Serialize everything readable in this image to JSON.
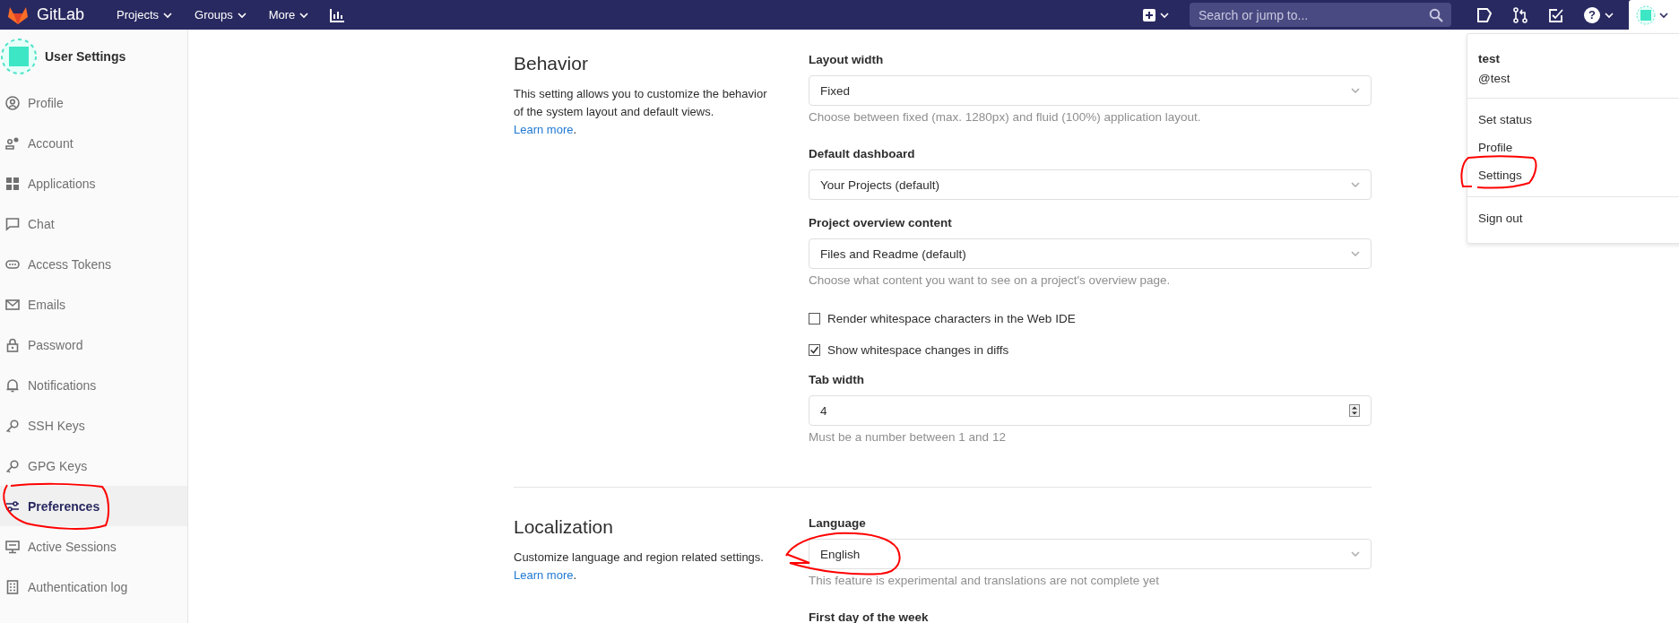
{
  "topbar": {
    "brand": "GitLab",
    "nav": [
      {
        "label": "Projects"
      },
      {
        "label": "Groups"
      },
      {
        "label": "More"
      }
    ],
    "search": {
      "placeholder": "Search or jump to..."
    },
    "help_glyph": "?"
  },
  "sidebar": {
    "title": "User Settings",
    "items": [
      {
        "label": "Profile",
        "selected": false
      },
      {
        "label": "Account",
        "selected": false
      },
      {
        "label": "Applications",
        "selected": false
      },
      {
        "label": "Chat",
        "selected": false
      },
      {
        "label": "Access Tokens",
        "selected": false
      },
      {
        "label": "Emails",
        "selected": false
      },
      {
        "label": "Password",
        "selected": false
      },
      {
        "label": "Notifications",
        "selected": false
      },
      {
        "label": "SSH Keys",
        "selected": false
      },
      {
        "label": "GPG Keys",
        "selected": false
      },
      {
        "label": "Preferences",
        "selected": true
      },
      {
        "label": "Active Sessions",
        "selected": false
      },
      {
        "label": "Authentication log",
        "selected": false
      }
    ]
  },
  "sections": [
    {
      "title": "Behavior",
      "description": "This setting allows you to customize the behavior of the system layout and default views.",
      "link": "Learn more",
      "after_link": ".",
      "fields": [
        {
          "kind": "select",
          "label": "Layout width",
          "value": "Fixed",
          "help": "Choose between fixed (max. 1280px) and fluid (100%) application layout."
        },
        {
          "kind": "select",
          "label": "Default dashboard",
          "value": "Your Projects (default)"
        },
        {
          "kind": "select",
          "label": "Project overview content",
          "value": "Files and Readme (default)",
          "help": "Choose what content you want to see on a project's overview page."
        },
        {
          "kind": "checkbox",
          "label": "Render whitespace characters in the Web IDE",
          "checked": false
        },
        {
          "kind": "checkbox",
          "label": "Show whitespace changes in diffs",
          "checked": true
        },
        {
          "kind": "number",
          "label": "Tab width",
          "value": "4",
          "help": "Must be a number between 1 and 12"
        }
      ]
    },
    {
      "title": "Localization",
      "description": "Customize language and region related settings.",
      "link": "Learn more",
      "after_link": ".",
      "fields": [
        {
          "kind": "select",
          "label": "Language",
          "value": "English",
          "help": "This feature is experimental and translations are not complete yet"
        },
        {
          "kind": "label",
          "label": "First day of the week"
        }
      ]
    }
  ],
  "user_menu": {
    "name": "test",
    "handle": "@test",
    "groups": [
      {
        "items": [
          "Set status",
          "Profile",
          "Settings"
        ]
      },
      {
        "items": [
          "Sign out"
        ]
      }
    ]
  }
}
